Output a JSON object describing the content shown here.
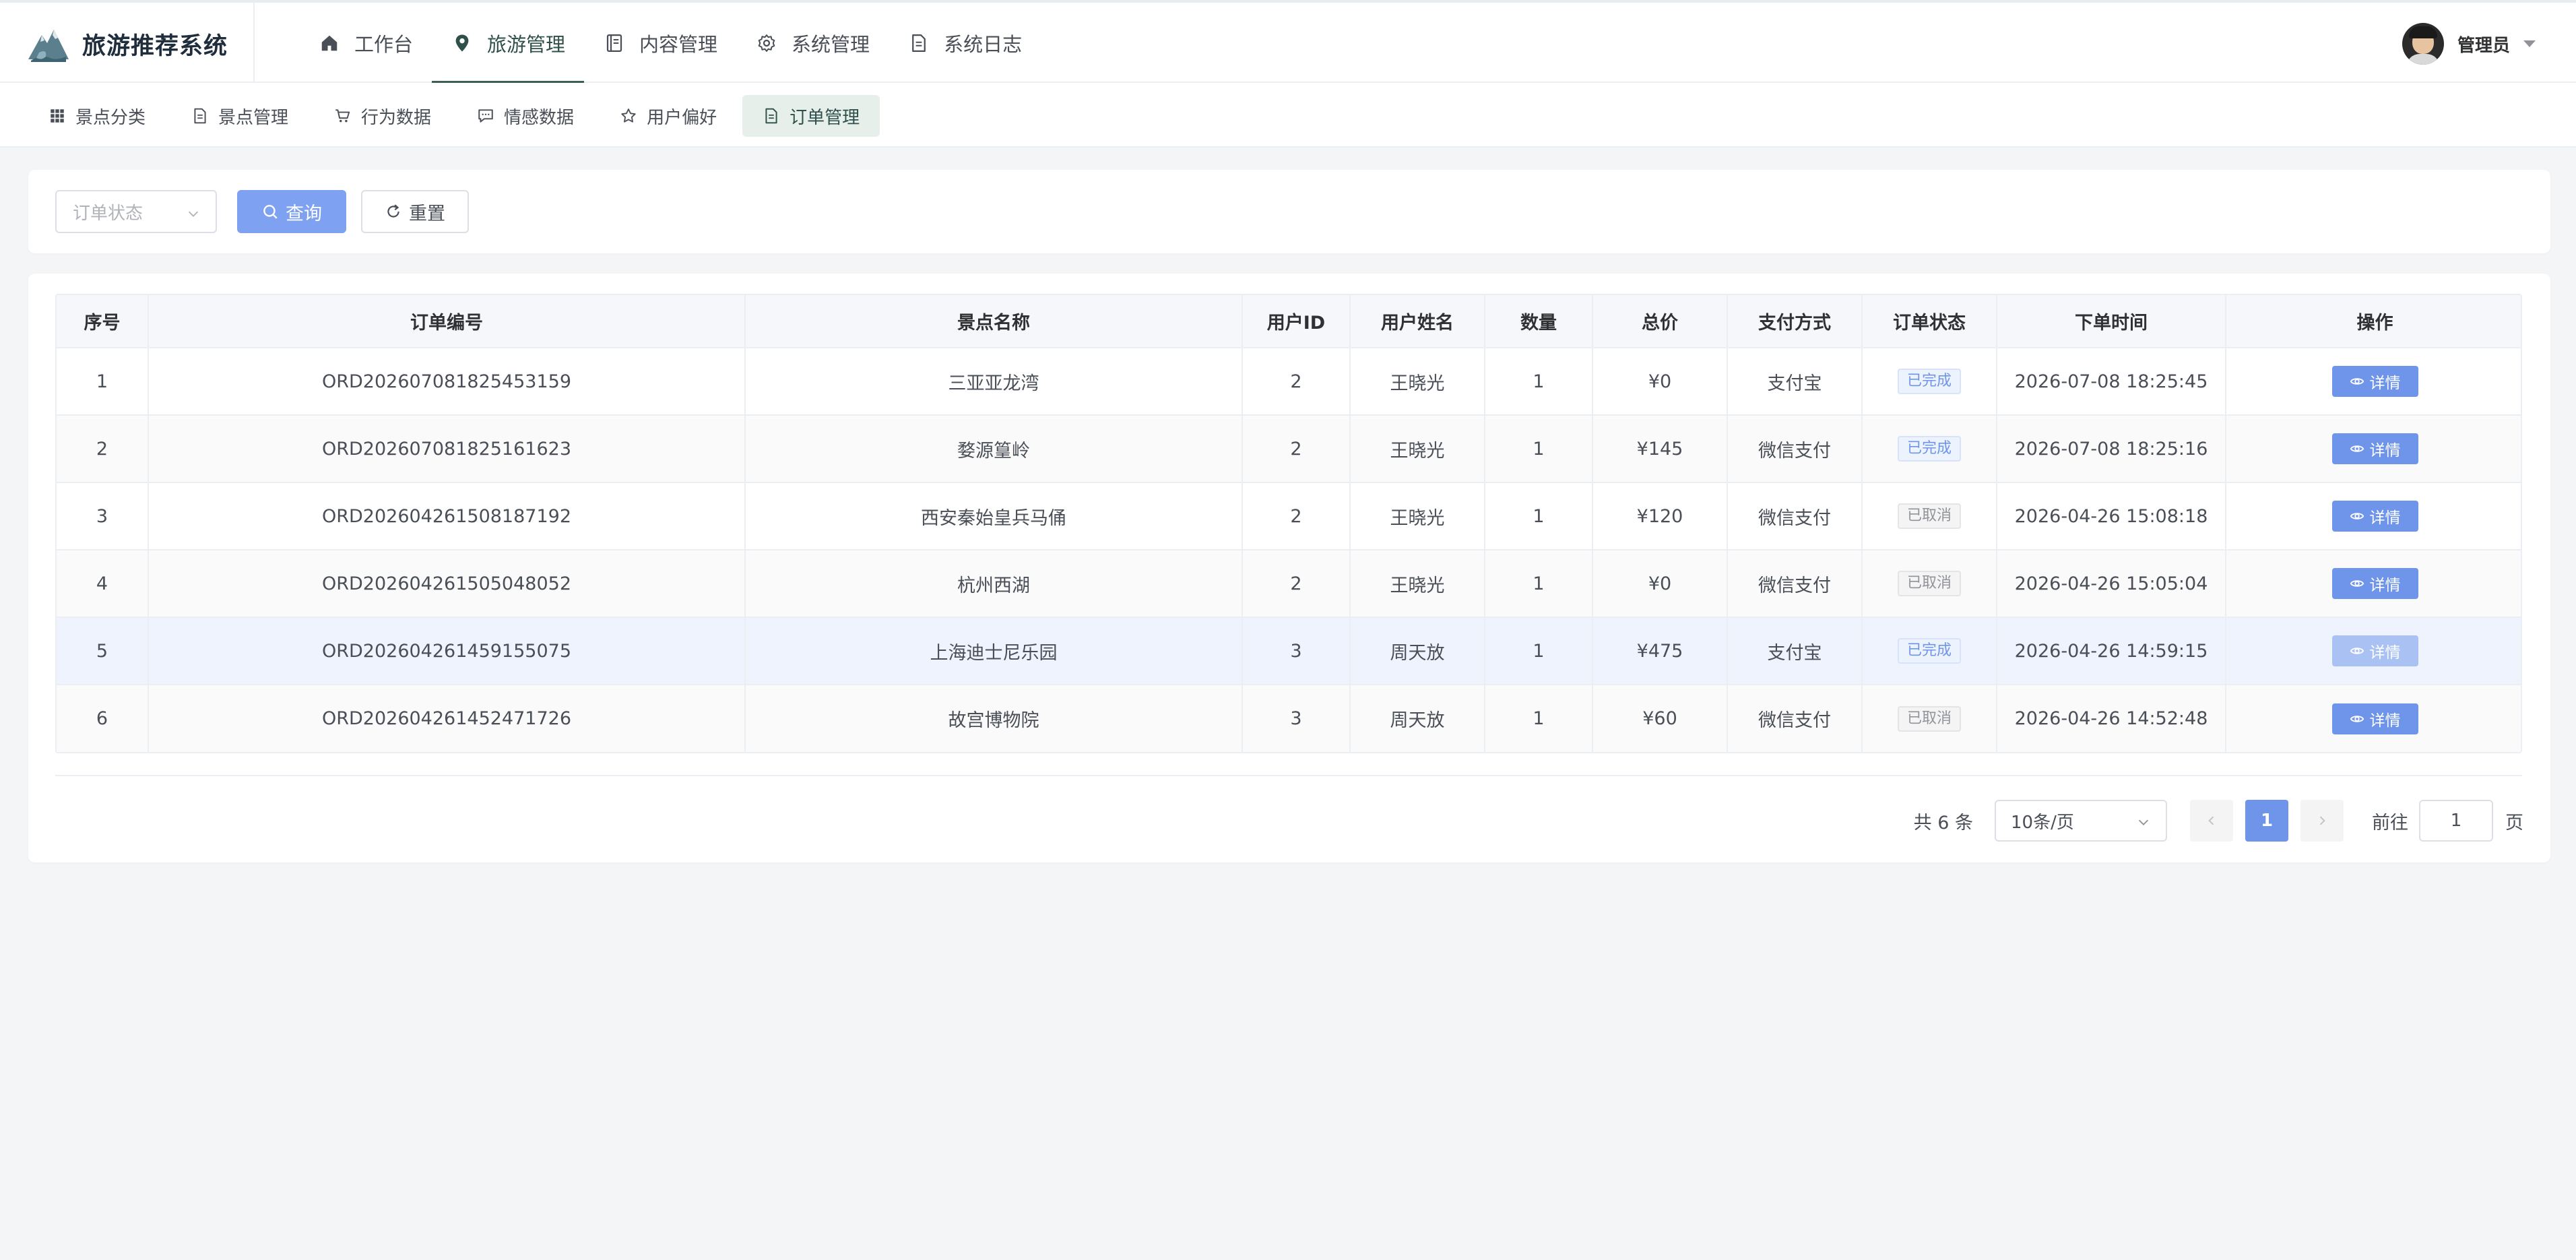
{
  "brand": {
    "title": "旅游推荐系统"
  },
  "topnav": [
    {
      "label": "工作台",
      "icon": "home-icon",
      "active": false
    },
    {
      "label": "旅游管理",
      "icon": "map-pin-icon",
      "active": true
    },
    {
      "label": "内容管理",
      "icon": "book-icon",
      "active": false
    },
    {
      "label": "系统管理",
      "icon": "gear-icon",
      "active": false
    },
    {
      "label": "系统日志",
      "icon": "document-icon",
      "active": false
    }
  ],
  "user": {
    "name": "管理员"
  },
  "subtabs": [
    {
      "label": "景点分类",
      "icon": "grid-icon",
      "active": false
    },
    {
      "label": "景点管理",
      "icon": "document-icon",
      "active": false
    },
    {
      "label": "行为数据",
      "icon": "cart-icon",
      "active": false
    },
    {
      "label": "情感数据",
      "icon": "chat-icon",
      "active": false
    },
    {
      "label": "用户偏好",
      "icon": "star-icon",
      "active": false
    },
    {
      "label": "订单管理",
      "icon": "document-icon",
      "active": true
    }
  ],
  "filter": {
    "status_placeholder": "订单状态",
    "query_label": "查询",
    "reset_label": "重置"
  },
  "table": {
    "columns": [
      "序号",
      "订单编号",
      "景点名称",
      "用户ID",
      "用户姓名",
      "数量",
      "总价",
      "支付方式",
      "订单状态",
      "下单时间",
      "操作"
    ],
    "detail_label": "详情",
    "rows": [
      {
        "idx": "1",
        "order_no": "ORD202607081825453159",
        "spot": "三亚亚龙湾",
        "user_id": "2",
        "user_name": "王晓光",
        "qty": "1",
        "total": "¥0",
        "pay": "支付宝",
        "status": "已完成",
        "status_type": "done",
        "time": "2026-07-08 18:25:45"
      },
      {
        "idx": "2",
        "order_no": "ORD202607081825161623",
        "spot": "婺源篁岭",
        "user_id": "2",
        "user_name": "王晓光",
        "qty": "1",
        "total": "¥145",
        "pay": "微信支付",
        "status": "已完成",
        "status_type": "done",
        "time": "2026-07-08 18:25:16"
      },
      {
        "idx": "3",
        "order_no": "ORD202604261508187192",
        "spot": "西安秦始皇兵马俑",
        "user_id": "2",
        "user_name": "王晓光",
        "qty": "1",
        "total": "¥120",
        "pay": "微信支付",
        "status": "已取消",
        "status_type": "cancel",
        "time": "2026-04-26 15:08:18"
      },
      {
        "idx": "4",
        "order_no": "ORD202604261505048052",
        "spot": "杭州西湖",
        "user_id": "2",
        "user_name": "王晓光",
        "qty": "1",
        "total": "¥0",
        "pay": "微信支付",
        "status": "已取消",
        "status_type": "cancel",
        "time": "2026-04-26 15:05:04"
      },
      {
        "idx": "5",
        "order_no": "ORD202604261459155075",
        "spot": "上海迪士尼乐园",
        "user_id": "3",
        "user_name": "周天放",
        "qty": "1",
        "total": "¥475",
        "pay": "支付宝",
        "status": "已完成",
        "status_type": "done",
        "time": "2026-04-26 14:59:15"
      },
      {
        "idx": "6",
        "order_no": "ORD202604261452471726",
        "spot": "故宫博物院",
        "user_id": "3",
        "user_name": "周天放",
        "qty": "1",
        "total": "¥60",
        "pay": "微信支付",
        "status": "已取消",
        "status_type": "cancel",
        "time": "2026-04-26 14:52:48"
      }
    ]
  },
  "pagination": {
    "total_text": "共 6 条",
    "page_size": "10条/页",
    "current_page": "1",
    "goto_label": "前往",
    "goto_value": "1",
    "unit_label": "页"
  },
  "colors": {
    "primary": "#6f95ea",
    "nav_active": "#3b5f57",
    "tab_active_bg": "#e6efe9"
  }
}
